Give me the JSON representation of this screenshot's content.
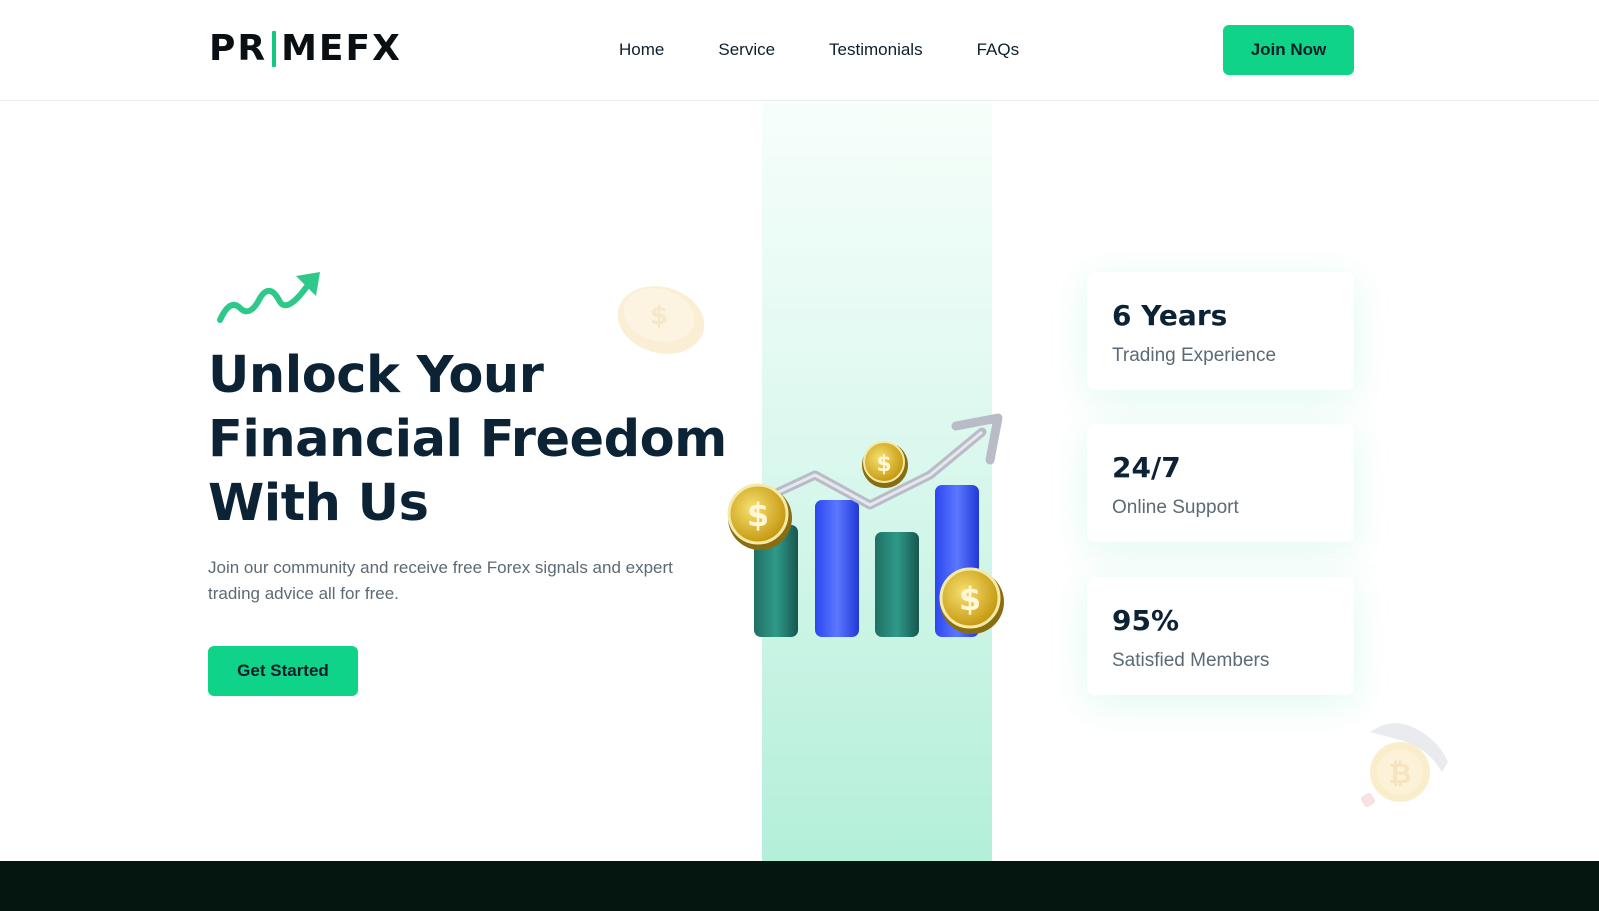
{
  "brand": {
    "logo_left": "PR",
    "logo_right": "MEFX",
    "accent": "#0fd389",
    "dark": "#0c2235"
  },
  "nav": {
    "items": [
      {
        "label": "Home"
      },
      {
        "label": "Service"
      },
      {
        "label": "Testimonials"
      },
      {
        "label": "FAQs"
      }
    ],
    "cta": "Join Now"
  },
  "hero": {
    "title": "Unlock Your Financial Freedom With Us",
    "description": "Join our community and receive free Forex signals and expert trading advice all for free.",
    "cta": "Get Started",
    "icon": "trend-up-arrow-icon"
  },
  "stats": [
    {
      "value": "6 Years",
      "label": "Trading Experience"
    },
    {
      "value": "24/7",
      "label": "Online Support"
    },
    {
      "value": "95%",
      "label": "Satisfied Members"
    }
  ]
}
